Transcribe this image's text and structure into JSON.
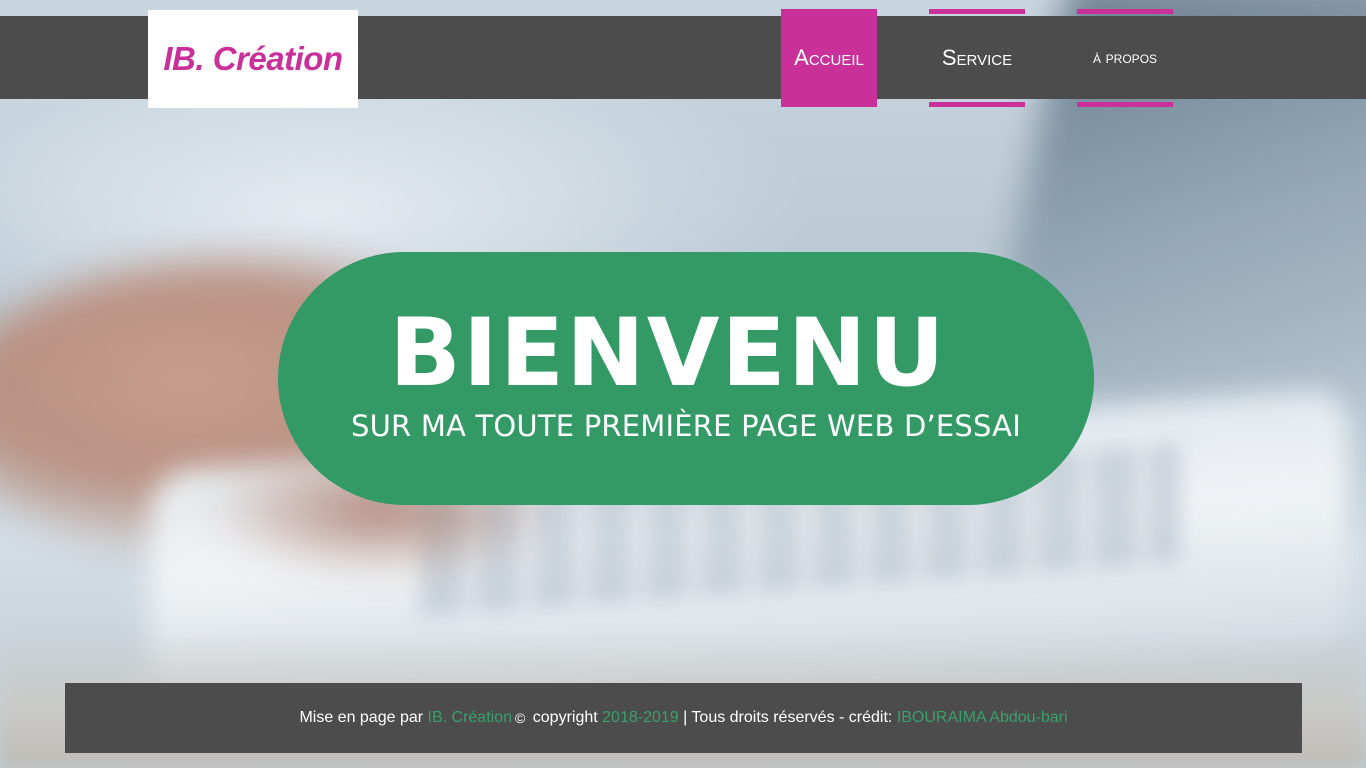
{
  "header": {
    "logo_text": "IB. Création",
    "nav": [
      {
        "label": "Accueil",
        "active": true
      },
      {
        "label": "Service",
        "active": false
      },
      {
        "label": "à propos",
        "active": false
      }
    ]
  },
  "hero": {
    "title": "BIENVENU",
    "subtitle": "SUR MA TOUTE PREMIÈRE PAGE WEB D’ESSAI"
  },
  "footer": {
    "prefix": "Mise en page par ",
    "brand": "IB. Création",
    "copyright_symbol": "©",
    "copyright_word": " copyright ",
    "years": "2018-2019",
    "rights": " | Tous droits réservés - crédit: ",
    "credit_name": "IBOURAIMA Abdou-bari"
  },
  "colors": {
    "brand_magenta": "#c9309a",
    "hero_green": "#339a66",
    "bar_gray": "#4c4c4c",
    "footer_accent_green": "#3aa06b"
  }
}
